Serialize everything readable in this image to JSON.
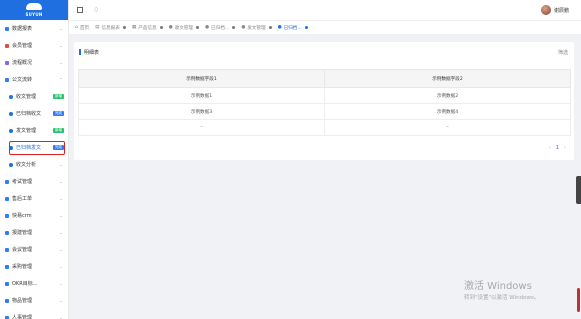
{
  "logo": {
    "text": "SUYUN"
  },
  "header": {
    "username": "谢辰鹏"
  },
  "tabs": [
    {
      "label": "首页",
      "icon": "house-icon",
      "active": false,
      "closable": false
    },
    {
      "label": "信息报表",
      "icon": "document-icon",
      "active": false,
      "closable": true
    },
    {
      "label": "产品信息",
      "icon": "product-icon",
      "active": false,
      "closable": true
    },
    {
      "label": "收文管理",
      "icon": "user-circle-icon",
      "active": false,
      "closable": true
    },
    {
      "label": "已归档...",
      "icon": "user-circle-icon",
      "active": false,
      "closable": true
    },
    {
      "label": "发文管理",
      "icon": "user-circle-icon",
      "active": false,
      "closable": true
    },
    {
      "label": "已归档...",
      "icon": "user-circle-icon",
      "active": true,
      "closable": true
    }
  ],
  "sidebar": {
    "items": [
      {
        "label": "数据报表",
        "color": "#2f7df6",
        "chevron": "⌄",
        "badge": ""
      },
      {
        "label": "会员管理",
        "color": "#e24b4b",
        "chevron": "⌄",
        "badge": ""
      },
      {
        "label": "流程概况",
        "color": "#7a6bf0",
        "chevron": "⌄",
        "badge": ""
      },
      {
        "label": "公文流转",
        "color": "#2f7df6",
        "chevron": "⌃",
        "badge": ""
      },
      {
        "label": "收文管理",
        "sub": true,
        "badge": "新增",
        "badge_color": "green"
      },
      {
        "label": "已归档收文",
        "sub": true,
        "badge": "完成",
        "badge_color": "blue"
      },
      {
        "label": "发文管理",
        "sub": true,
        "badge": "新增",
        "badge_color": "green"
      },
      {
        "label": "已归档发文",
        "sub": true,
        "badge": "完成",
        "badge_color": "blue",
        "active": true
      },
      {
        "label": "收文分析",
        "sub": true,
        "chevron": "⌄",
        "badge": ""
      },
      {
        "label": "考试管理",
        "color": "#2f7df6",
        "chevron": "⌄",
        "badge": ""
      },
      {
        "label": "售后工单",
        "color": "#2f7df6",
        "chevron": "⌄",
        "badge": ""
      },
      {
        "label": "快易crm",
        "color": "#2f7df6",
        "chevron": "⌄",
        "badge": ""
      },
      {
        "label": "报建管理",
        "color": "#2f7df6",
        "chevron": "⌄",
        "badge": ""
      },
      {
        "label": "会议管理",
        "color": "#2f7df6",
        "chevron": "⌄",
        "badge": ""
      },
      {
        "label": "采购管理",
        "color": "#2f7df6",
        "chevron": "⌄",
        "badge": ""
      },
      {
        "label": "OKR目标...",
        "color": "#2f7df6",
        "chevron": "⌄",
        "badge": ""
      },
      {
        "label": "物品管理",
        "color": "#2f7df6",
        "chevron": "⌄",
        "badge": ""
      },
      {
        "label": "人事管理",
        "color": "#2f7df6",
        "chevron": "⌄",
        "badge": ""
      }
    ]
  },
  "panel": {
    "title": "明细表",
    "filter_label": "筛选",
    "columns": [
      "示例数据字段1",
      "示例数据字段2"
    ],
    "rows": [
      [
        "示例数据1",
        "示例数据2"
      ],
      [
        "示例数据3",
        "示例数据4"
      ],
      [
        "–",
        "–"
      ]
    ],
    "pager": {
      "prev": "‹",
      "current": "1",
      "next": "›"
    }
  },
  "watermark": {
    "line1": "激活 Windows",
    "line2": "转到\"设置\"以激活 Windows。"
  }
}
